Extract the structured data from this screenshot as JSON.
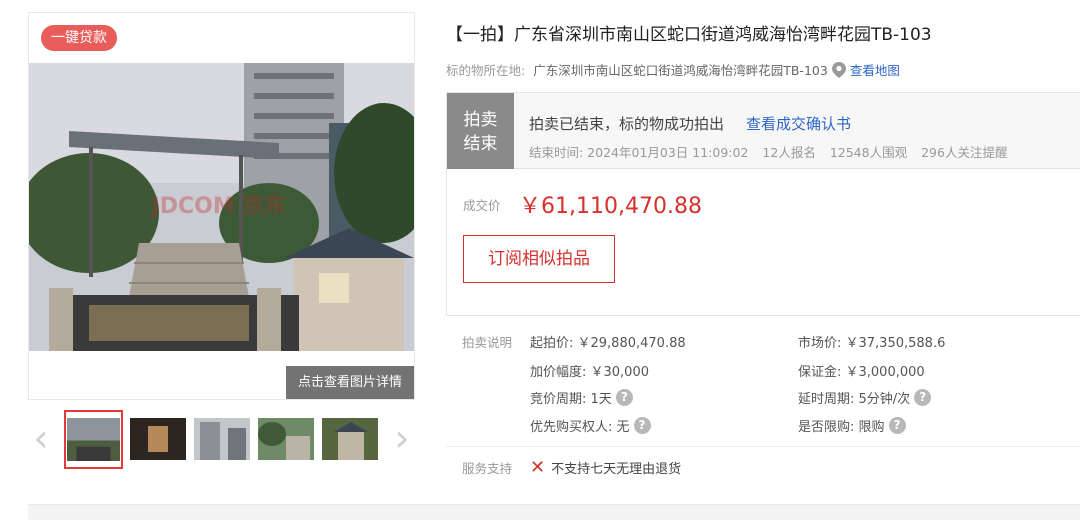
{
  "gallery": {
    "badge": "一键贷款",
    "view_detail": "点击查看图片详情",
    "watermark": "JDCOM 京东",
    "thumbnails": [
      "thumb-1",
      "thumb-2",
      "thumb-3",
      "thumb-4",
      "thumb-5"
    ],
    "prev_icon": "chevron-left-icon",
    "next_icon": "chevron-right-icon"
  },
  "listing": {
    "title": "【一拍】广东省深圳市南山区蛇口街道鸿威海怡湾畔花园TB-103",
    "location_label": "标的物所在地:",
    "location_value": "广东深圳市南山区蛇口街道鸿威海怡湾畔花园TB-103",
    "map_link": "查看地图",
    "pin_icon": "location-pin-icon"
  },
  "status": {
    "tag_line1": "拍卖",
    "tag_line2": "结束",
    "main": "拍卖已结束，标的物成功拍出",
    "confirm_link": "查看成交确认书",
    "end_time": "结束时间:  2024年01月03日 11:09:02",
    "signups": "12人报名",
    "viewers": "12548人围观",
    "followers": "296人关注提醒"
  },
  "deal": {
    "label": "成交价",
    "price": "￥61,110,470.88",
    "subscribe_button": "订阅相似拍品"
  },
  "rules": {
    "label": "拍卖说明",
    "start_price": "起拍价:  ￥29,880,470.88",
    "market_price": "市场价:  ￥37,350,588.6",
    "increment": "加价幅度:  ￥30,000",
    "deposit": "保证金:  ￥3,000,000",
    "bid_period": "竞价周期:  1天",
    "extension": "延时周期:  5分钟/次",
    "priority": "优先购买权人:  无",
    "purchase_limit": "是否限购:  限购",
    "help_icon": "question-mark-icon"
  },
  "service": {
    "label": "服务支持",
    "value": "不支持七天无理由退货",
    "icon": "x-mark-icon"
  },
  "colors": {
    "accent_red": "#d6312c",
    "link_blue": "#2c65c6",
    "badge_red": "#e85d5a",
    "tag_gray": "#8a8a8a"
  }
}
